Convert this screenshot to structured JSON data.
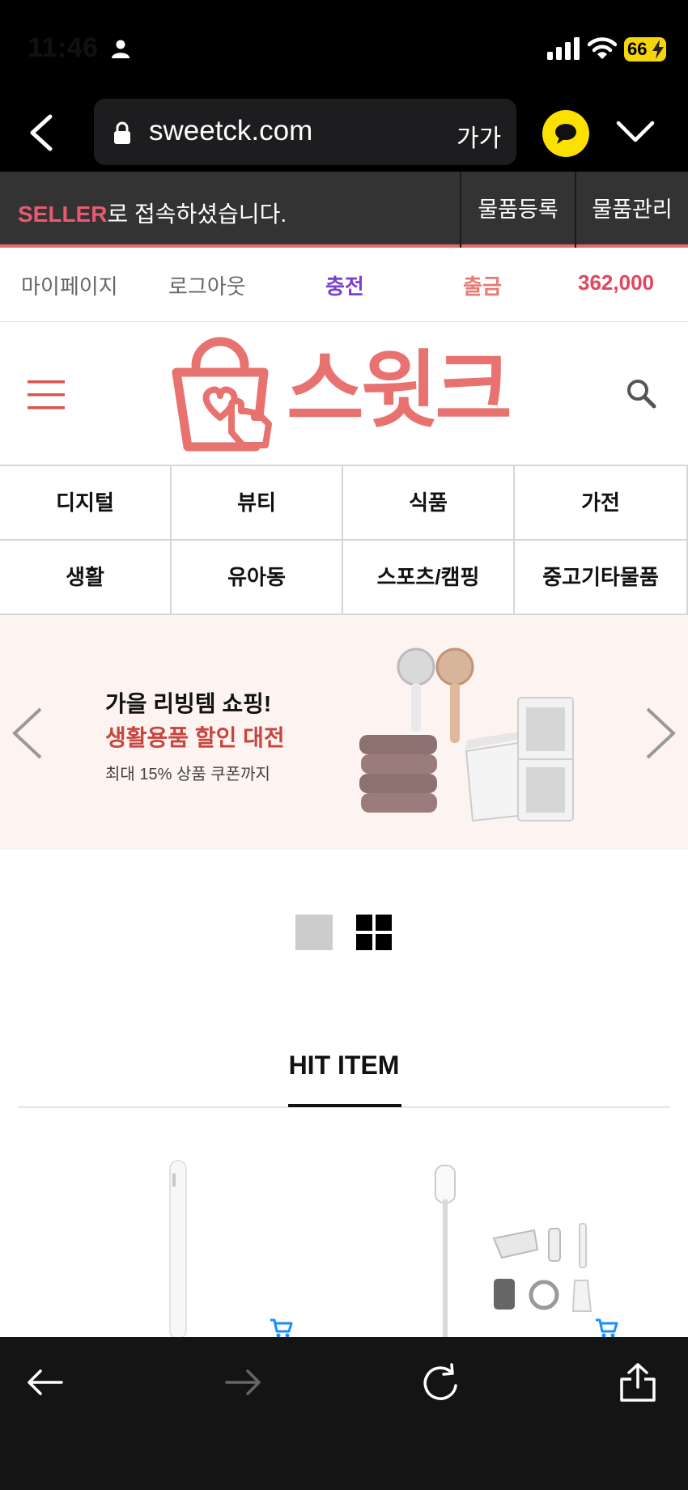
{
  "status_bar": {
    "time": "11:46",
    "battery": "66"
  },
  "browser": {
    "url": "sweetck.com",
    "text_size_label": "가가"
  },
  "seller_bar": {
    "highlight": "SELLER",
    "message": "로 접속하셨습니다.",
    "register_label": "물품등록",
    "manage_label": "물품관리"
  },
  "user_bar": {
    "mypage": "마이페이지",
    "logout": "로그아웃",
    "charge": "충전",
    "withdraw": "출금",
    "balance": "362,000"
  },
  "logo": {
    "text": "스윗크",
    "color": "#e8726f"
  },
  "categories": [
    "디지털",
    "뷰티",
    "식품",
    "가전",
    "생활",
    "유아동",
    "스포츠/캠핑",
    "중고기타물품"
  ],
  "banner": {
    "title": "가을 리빙템 쇼핑!",
    "subtitle": "생활용품 할인 대전",
    "note": "최대 15% 상품 쿠폰까지",
    "background": "#fdf3f0"
  },
  "section": {
    "title": "HIT ITEM"
  },
  "colors": {
    "accent": "#e46b6b",
    "purple": "#7b3fd0",
    "balance_red": "#e2465c",
    "cart_blue": "#1a8cff"
  }
}
